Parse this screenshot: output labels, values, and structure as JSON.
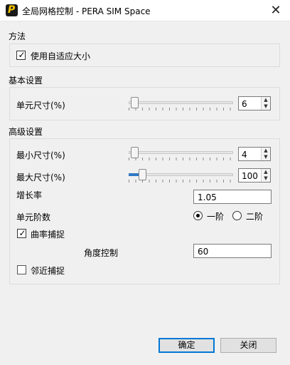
{
  "window": {
    "title": "全局网格控制 - PERA SIM Space",
    "icon": "pera-app-icon",
    "close_glyph": "✕"
  },
  "method": {
    "title": "方法",
    "adaptive_label": "使用自适应大小",
    "adaptive_checked": true
  },
  "basic": {
    "title": "基本设置",
    "unit_size_label": "单元尺寸(%)",
    "unit_size_value": "6",
    "unit_size_slider_fraction": 0.02
  },
  "advanced": {
    "title": "高级设置",
    "min_size_label": "最小尺寸(%)",
    "min_size_value": "4",
    "min_size_slider_fraction": 0.02,
    "max_size_label": "最大尺寸(%)",
    "max_size_value": "100",
    "max_size_slider_fraction": 0.1,
    "growth_label": "增长率",
    "growth_value": "1.05",
    "order_label": "单元阶数",
    "order_option_1": "一阶",
    "order_option_2": "二阶",
    "order_selected": 1,
    "curvature_label": "曲率捕捉",
    "curvature_checked": true,
    "angle_label": "角度控制",
    "angle_value": "60",
    "proximity_label": "邻近捕捉",
    "proximity_checked": false
  },
  "buttons": {
    "ok": "确定",
    "close": "关闭"
  },
  "colors": {
    "accent": "#0078d7",
    "slider_fill": "#2f78c4",
    "background": "#f0f0f0"
  }
}
